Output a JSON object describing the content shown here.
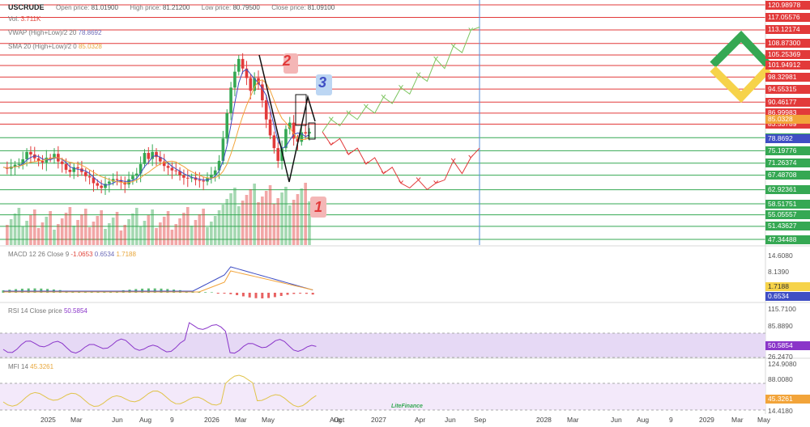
{
  "header": {
    "symbol": "USCRUDE",
    "open_label": "Open price:",
    "open_value": "81.01900",
    "high_label": "High price:",
    "high_value": "81.21200",
    "low_label": "Low price:",
    "low_value": "80.79500",
    "close_label": "Close price:",
    "close_value": "81.09100",
    "vol_label": "Vol.",
    "vol_value": "3.711K",
    "vwap_label": "VWAP (High+Low)/2 20",
    "vwap_value": "78.8692",
    "sma_label": "SMA 20 (High+Low)/2 0",
    "sma_value": "85.0328"
  },
  "indicators": {
    "macd_label": "MACD 12 26 Close 9",
    "macd_values": [
      "-1.0653",
      "0.6534",
      "1.7188"
    ],
    "rsi_label": "RSI 14 Close price",
    "rsi_value": "50.5854",
    "mfi_label": "MFI 14",
    "mfi_value": "45.3261"
  },
  "annotations": {
    "one": "1",
    "two": "2",
    "three": "3"
  },
  "colors": {
    "up": "#35a853",
    "down": "#e23a3a",
    "vwap": "#3f4ec4",
    "sma": "#f2a43a",
    "resistance": "#e23a3a",
    "support": "#35a853",
    "rsi": "#8a35c9",
    "mfi": "#e0c34a",
    "logo_green": "#35a853",
    "logo_yellow": "#f6d34a"
  },
  "watermark": "LiteFinance",
  "chart_data": [
    {
      "type": "line",
      "title": "USCRUDE",
      "y_tick_labels": [
        "120.98978",
        "117.05576",
        "113.12174",
        "108.87300",
        "105.25369",
        "101.94912",
        "98.32981",
        "94.55315",
        "90.46177",
        "86.99983",
        "85.0328",
        "83.53789",
        "79.28915",
        "78.8692",
        "75.19776",
        "71.26374",
        "67.48708",
        "62.92361",
        "58.51751",
        "55.05557",
        "51.43627",
        "47.34488"
      ],
      "price_level_labels": {
        "resistance": [
          "120.98978",
          "117.05576",
          "113.12174",
          "108.87300",
          "105.25369",
          "101.94912",
          "98.32981",
          "94.55315",
          "90.46177",
          "86.99983",
          "83.53789"
        ],
        "support": [
          "79.28915",
          "75.19776",
          "71.26374",
          "67.48708",
          "62.92361",
          "58.51751",
          "55.05557",
          "51.43627",
          "47.34488"
        ]
      },
      "x_tick_labels": [
        "2025",
        "Mar",
        "Jun",
        "Aug",
        "9",
        "2026",
        "Mar",
        "May",
        "Jul",
        "Aug",
        "Oct",
        "2027",
        "Apr",
        "Jun",
        "Sep",
        "2028",
        "Mar",
        "Jun",
        "Aug",
        "9",
        "2029",
        "Mar",
        "May"
      ],
      "price_series": [
        70,
        69.5,
        70.2,
        70.8,
        71,
        72.5,
        74.8,
        74,
        72.8,
        72,
        71.5,
        73,
        72.8,
        74.2,
        71.8,
        71,
        69.2,
        68.5,
        70,
        69.6,
        68.5,
        67.2,
        66.8,
        65,
        64.2,
        63.5,
        64.8,
        65.5,
        66.3,
        66,
        65.3,
        64.6,
        66.2,
        67.3,
        68,
        71,
        74.5,
        72.6,
        74.8,
        73.2,
        71.8,
        70.4,
        69.8,
        69,
        68.8,
        67.5,
        66.7,
        66.5,
        66.8,
        66,
        65.8,
        65.5,
        66.6,
        67.7,
        69,
        72,
        79,
        87,
        95,
        100,
        104,
        101,
        98,
        94,
        98,
        96,
        91,
        85,
        80,
        76,
        72,
        76,
        82,
        84,
        79,
        78,
        81,
        80.6,
        81.09
      ],
      "bullish_forecast": [
        81.1,
        85,
        83,
        87,
        85,
        89,
        87,
        92,
        90,
        95,
        93,
        99,
        97,
        104,
        101,
        108,
        106,
        113,
        114
      ],
      "bearish_forecast": [
        81.1,
        77,
        79,
        74,
        76,
        71,
        73,
        68,
        70,
        65,
        63.5,
        66,
        63,
        65,
        66,
        72,
        68,
        73,
        76
      ],
      "macd": {
        "values": [
          -1.0653,
          0.6534,
          1.7188
        ],
        "axis_labels": [
          "14.6080",
          "8.1390",
          "1.7188",
          "0.6534"
        ]
      },
      "rsi": {
        "value": 50.5854,
        "axis_labels": [
          "115.7100",
          "85.8890",
          "50.5854",
          "26.2470"
        ]
      },
      "mfi": {
        "value": 45.3261,
        "axis_labels": [
          "124.9080",
          "88.0080",
          "45.3261",
          "14.4180"
        ]
      }
    }
  ]
}
